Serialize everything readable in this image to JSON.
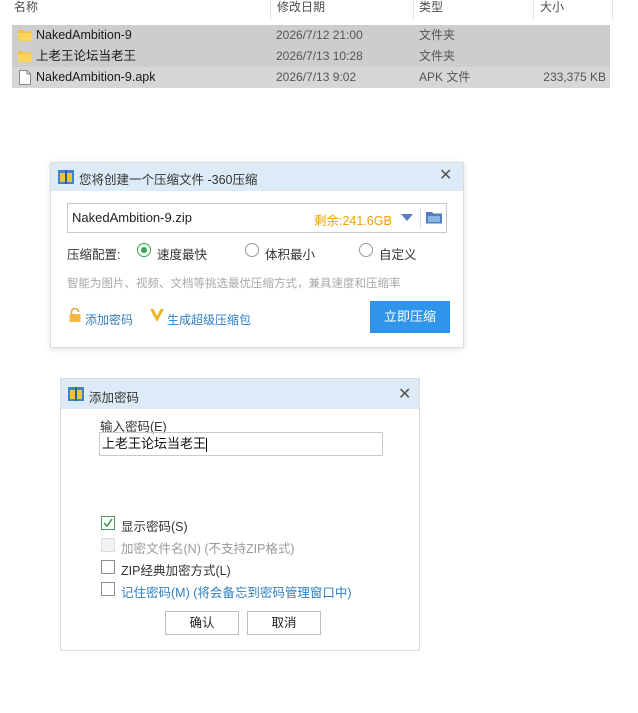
{
  "explorer": {
    "columns": {
      "name": "名称",
      "date": "修改日期",
      "type": "类型",
      "size": "大小"
    },
    "files": [
      {
        "name": "NakedAmbition-9",
        "date": "2026/7/12 21:00",
        "type": "文件夹",
        "size": "",
        "icon": "folder-icon"
      },
      {
        "name": "上老王论坛当老王",
        "date": "2026/7/13 10:28",
        "type": "文件夹",
        "size": "",
        "icon": "folder-icon"
      },
      {
        "name": "NakedAmbition-9.apk",
        "date": "2026/7/13 9:02",
        "type": "APK 文件",
        "size": "233,375 KB",
        "icon": "file-icon"
      }
    ]
  },
  "compress_dialog": {
    "title": "您将创建一个压缩文件 -360压缩",
    "filename": "NakedAmbition-9.zip",
    "remaining": "剩余:241.6GB",
    "config_label": "压缩配置:",
    "options": [
      "速度最快",
      "体积最小",
      "自定义"
    ],
    "selected_option": "速度最快",
    "description": "智能为图片、视频、文档等挑选最优压缩方式，兼具速度和压缩率",
    "add_password": "添加密码",
    "super_package": "生成超级压缩包",
    "compress_button": "立即压缩"
  },
  "password_dialog": {
    "title": "添加密码",
    "input_label": "输入密码(E)",
    "password_value": "上老王论坛当老王",
    "checkboxes": [
      {
        "label": "显示密码(S)",
        "checked": true,
        "enabled": true
      },
      {
        "label": "加密文件名(N) (不支持ZIP格式)",
        "checked": false,
        "enabled": false
      },
      {
        "label": "ZIP经典加密方式(L)",
        "checked": false,
        "enabled": true
      },
      {
        "label": "记住密码(M) (将会备忘到密码管理窗口中)",
        "checked": false,
        "enabled": true
      }
    ],
    "ok_button": "确认",
    "cancel_button": "取消"
  },
  "colors": {
    "accent": "#2f95ea",
    "title_bar": "#dcebf7",
    "link": "#2f7fc1",
    "remain": "#f0a000",
    "radio": "#2ea84b"
  }
}
